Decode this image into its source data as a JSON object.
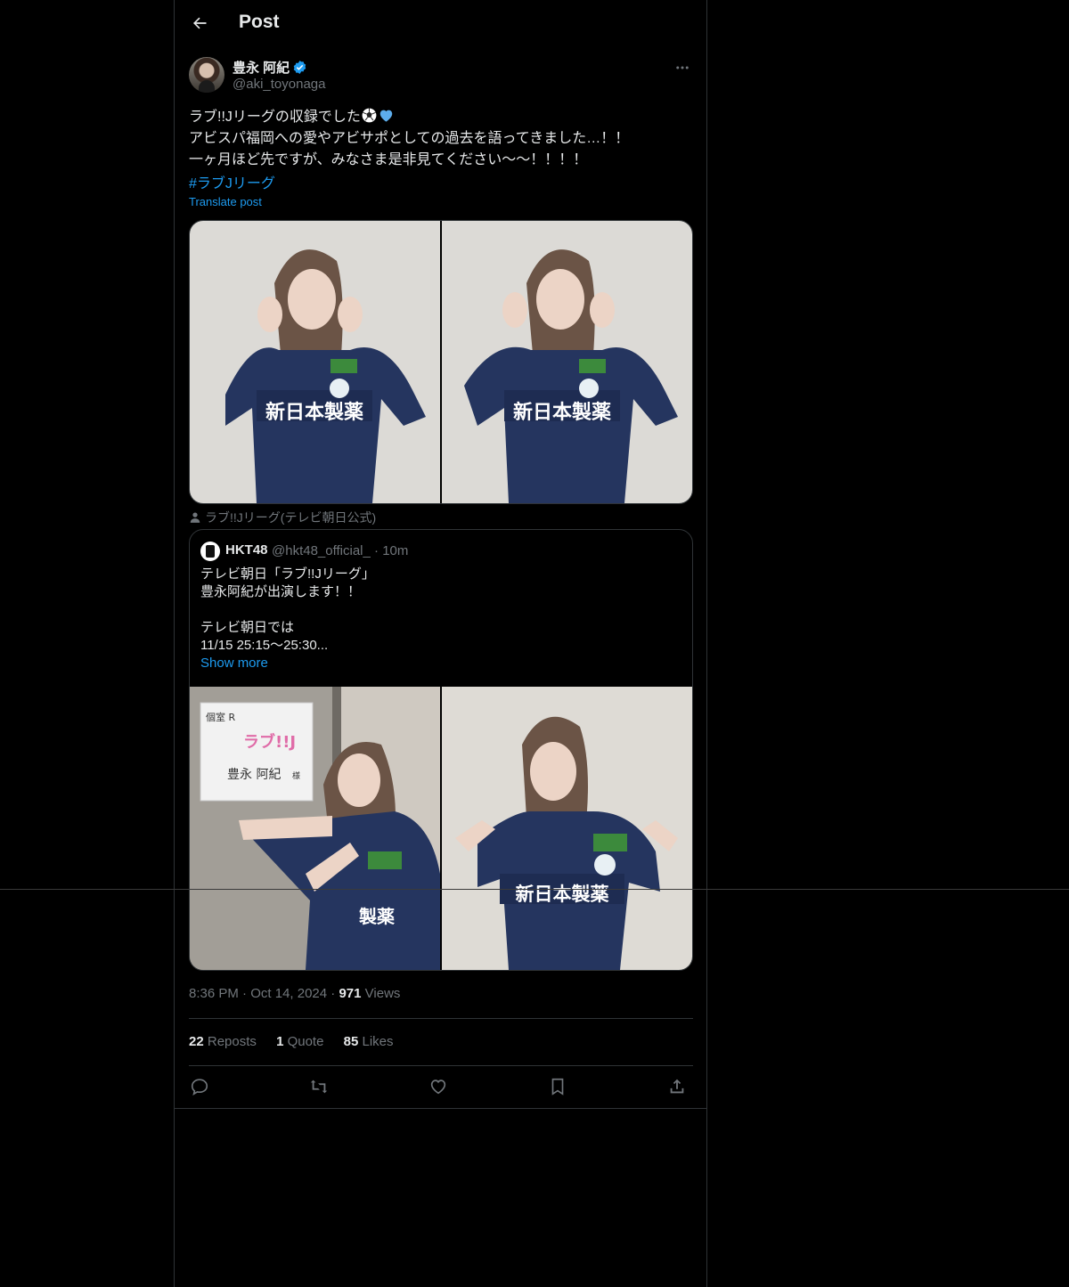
{
  "header": {
    "title": "Post",
    "back_icon": "arrow-left-icon"
  },
  "author": {
    "name": "豊永 阿紀",
    "handle": "@aki_toyonaga",
    "verified_icon": "verified-badge-icon"
  },
  "tweet": {
    "line1": "ラブ!!Jリーグの収録でした",
    "emoji_icons": [
      "soccer-ball-icon",
      "blue-heart-icon"
    ],
    "line2": "アビスパ福岡への愛やアビサポとしての過去を語ってきました…！！",
    "line3": "一ヶ月ほど先ですが、みなさま是非見てください〜〜！！！！",
    "hashtag": "#ラブJリーグ",
    "translate": "Translate post"
  },
  "tagged": "ラブ!!Jリーグ(テレビ朝日公式)",
  "quote": {
    "name": "HKT48",
    "handle": "@hkt48_official_",
    "time": "· 10m",
    "text": "テレビ朝日「ラブ!!Jリーグ」\n豊永阿紀が出演します！！\n\nテレビ朝日では\n11/15 25:15〜25:30...",
    "show_more": "Show more",
    "sign_line1": "個室 R",
    "sign_name": "豊永 阿紀",
    "sign_suffix": "様"
  },
  "meta": {
    "time": "8:36 PM",
    "date": "Oct 14, 2024",
    "views_count": "971",
    "views_label": "Views"
  },
  "stats": {
    "reposts_count": "22",
    "reposts_label": "Reposts",
    "quotes_count": "1",
    "quotes_label": "Quote",
    "likes_count": "85",
    "likes_label": "Likes"
  },
  "colors": {
    "accent": "#1d9bf0",
    "background": "#000000",
    "text": "#e7e9ea",
    "muted": "#71767b",
    "border": "#2f3336"
  }
}
